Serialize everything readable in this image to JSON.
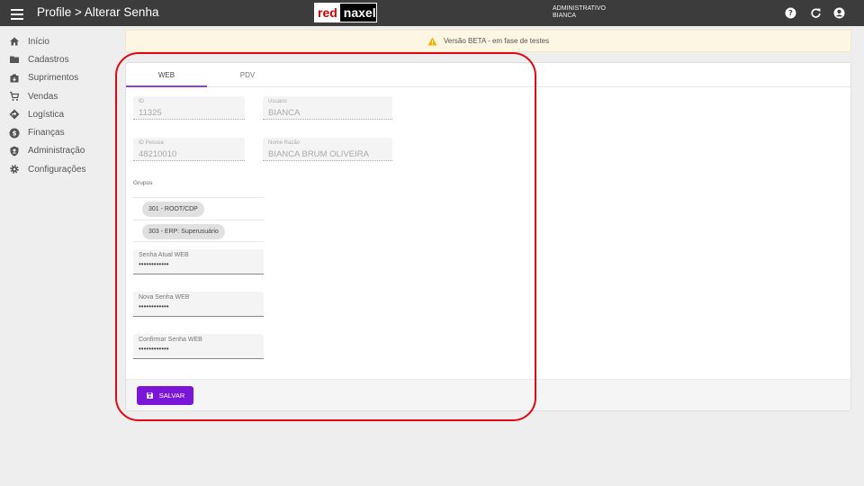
{
  "header": {
    "title": "Profile > Alterar Senha",
    "logo_red": "red",
    "logo_naxel": "naxel",
    "user_role": "ADMINISTRATIVO",
    "user_name": "BIANCA",
    "icons": [
      "help-icon",
      "refresh-icon",
      "account-icon"
    ]
  },
  "sidebar": {
    "items": [
      {
        "label": "Início",
        "icon": "home-icon"
      },
      {
        "label": "Cadastros",
        "icon": "folder-icon"
      },
      {
        "label": "Suprimentos",
        "icon": "supply-icon"
      },
      {
        "label": "Vendas",
        "icon": "cart-icon"
      },
      {
        "label": "Logística",
        "icon": "route-icon"
      },
      {
        "label": "Finanças",
        "icon": "money-icon"
      },
      {
        "label": "Administração",
        "icon": "shield-icon"
      },
      {
        "label": "Configurações",
        "icon": "gear-icon"
      }
    ]
  },
  "banner": {
    "text": "Versão BETA - em fase de testes",
    "icon": "warning-icon"
  },
  "tabs": [
    {
      "label": "WEB",
      "active": true
    },
    {
      "label": "PDV",
      "active": false
    }
  ],
  "form": {
    "id": {
      "label": "ID",
      "value": "11325"
    },
    "usuario": {
      "label": "Usuário",
      "value": "BIANCA"
    },
    "id_pessoa": {
      "label": "ID Pessoa",
      "value": "48210010"
    },
    "nome_razao": {
      "label": "Nome Razão",
      "value": "BIANCA BRUM OLIVEIRA"
    },
    "grupos_label": "Grupos",
    "grupos": [
      "301 - ROOT/CDP",
      "303 - ERP: Superusuário"
    ],
    "senha_atual": {
      "label": "Senha Atual WEB",
      "value": "••••••••••••"
    },
    "nova_senha": {
      "label": "Nova Senha WEB",
      "value": "••••••••••••"
    },
    "confirmar_senha": {
      "label": "Confirmar Senha WEB",
      "value": "••••••••••••"
    },
    "save_label": "SALVAR"
  },
  "colors": {
    "topbar": "#3c3c3c",
    "accent": "#7b16d9",
    "highlight": "#e30613"
  }
}
